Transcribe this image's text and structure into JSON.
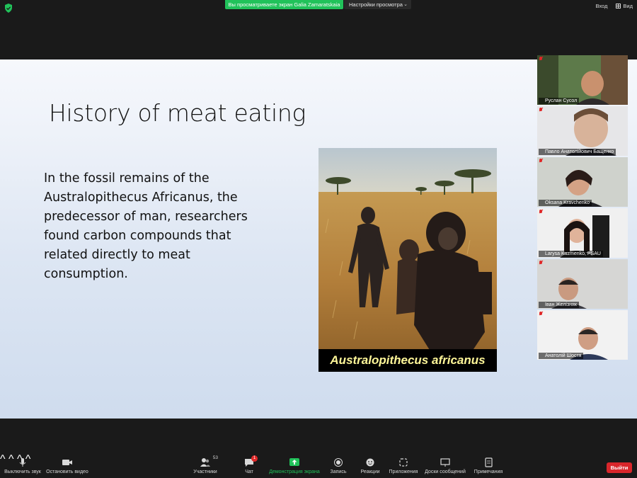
{
  "topbar": {
    "share_banner": "Вы просматриваете экран Galia Zamaratskaia",
    "view_options": "Настройки просмотра",
    "enter_label": "Вход",
    "view_label": "Вид"
  },
  "slide": {
    "title": "History of meat eating",
    "body": "In the fossil remains of the Australopithecus Africanus, the predecessor of man, researchers found carbon compounds that related directly to meat consumption.",
    "image_caption": "Australopithecus africanus"
  },
  "participants": [
    {
      "name": "Руслан Сусол"
    },
    {
      "name": "Павло Анатолійович Бащенко"
    },
    {
      "name": "Oksana Kravchenko"
    },
    {
      "name": "Larysa Kuzmenko, PSAU"
    },
    {
      "name": "Іван Желізняк"
    },
    {
      "name": "Анатолій Шостя"
    }
  ],
  "toolbar": {
    "mute_label": "Выключить звук",
    "video_label": "Остановить видео",
    "participants_label": "Участники",
    "participants_count": "53",
    "chat_label": "Чат",
    "chat_badge": "1",
    "share_label": "Демонстрация экрана",
    "record_label": "Запись",
    "reactions_label": "Реакции",
    "apps_label": "Приложения",
    "whiteboard_label": "Доски сообщений",
    "notes_label": "Примечания",
    "leave_label": "Выйти"
  },
  "colors": {
    "share_green": "#21c25a",
    "leave_red": "#d9262b",
    "caption_yellow": "#fff799"
  }
}
